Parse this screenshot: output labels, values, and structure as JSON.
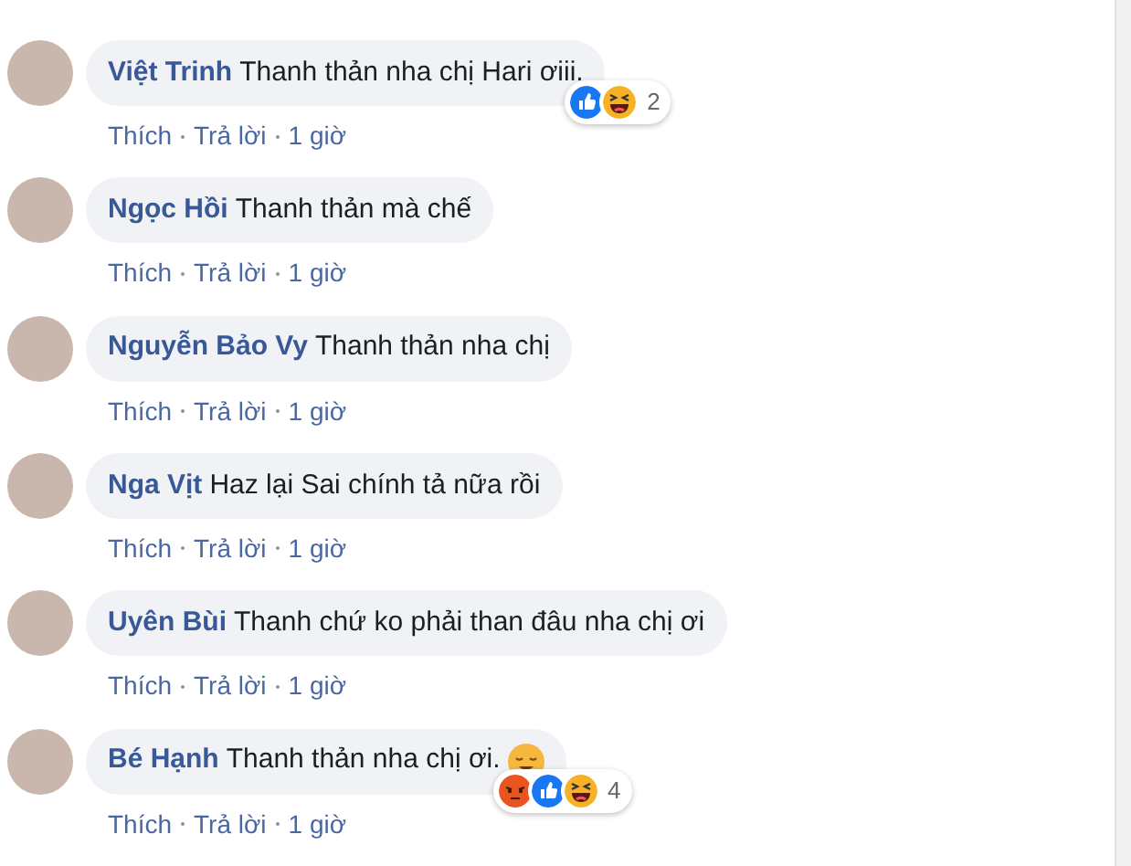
{
  "comments": [
    {
      "author": "Việt Trinh",
      "text": "Thanh thản nha chị Hari ơiii.",
      "actions": [
        "Thích",
        "Trả lời"
      ],
      "time": "1 giờ",
      "reactions": [
        {
          "kind": "like"
        },
        {
          "kind": "haha"
        }
      ],
      "reaction_count": "2"
    },
    {
      "author": "Ngọc Hồi",
      "text": "Thanh thản mà chế",
      "actions": [
        "Thích",
        "Trả lời"
      ],
      "time": "1 giờ"
    },
    {
      "author": "Nguyễn Bảo Vy",
      "text": "Thanh thản nha chị",
      "actions": [
        "Thích",
        "Trả lời"
      ],
      "time": "1 giờ"
    },
    {
      "author": "Nga Vịt",
      "text": "Haz lại Sai chính tả nữa rồi",
      "actions": [
        "Thích",
        "Trả lời"
      ],
      "time": "1 giờ"
    },
    {
      "author": "Uyên Bùi",
      "text": "Thanh chứ ko phải than đâu nha chị ơi",
      "actions": [
        "Thích",
        "Trả lời"
      ],
      "time": "1 giờ"
    },
    {
      "author": "Bé Hạnh",
      "text": "Thanh thản nha chị ơi.",
      "emoji": {
        "kind": "relieved"
      },
      "actions": [
        "Thích",
        "Trả lời"
      ],
      "time": "1 giờ",
      "reactions": [
        {
          "kind": "angry"
        },
        {
          "kind": "like"
        },
        {
          "kind": "haha"
        }
      ],
      "reaction_count": "4"
    }
  ]
}
